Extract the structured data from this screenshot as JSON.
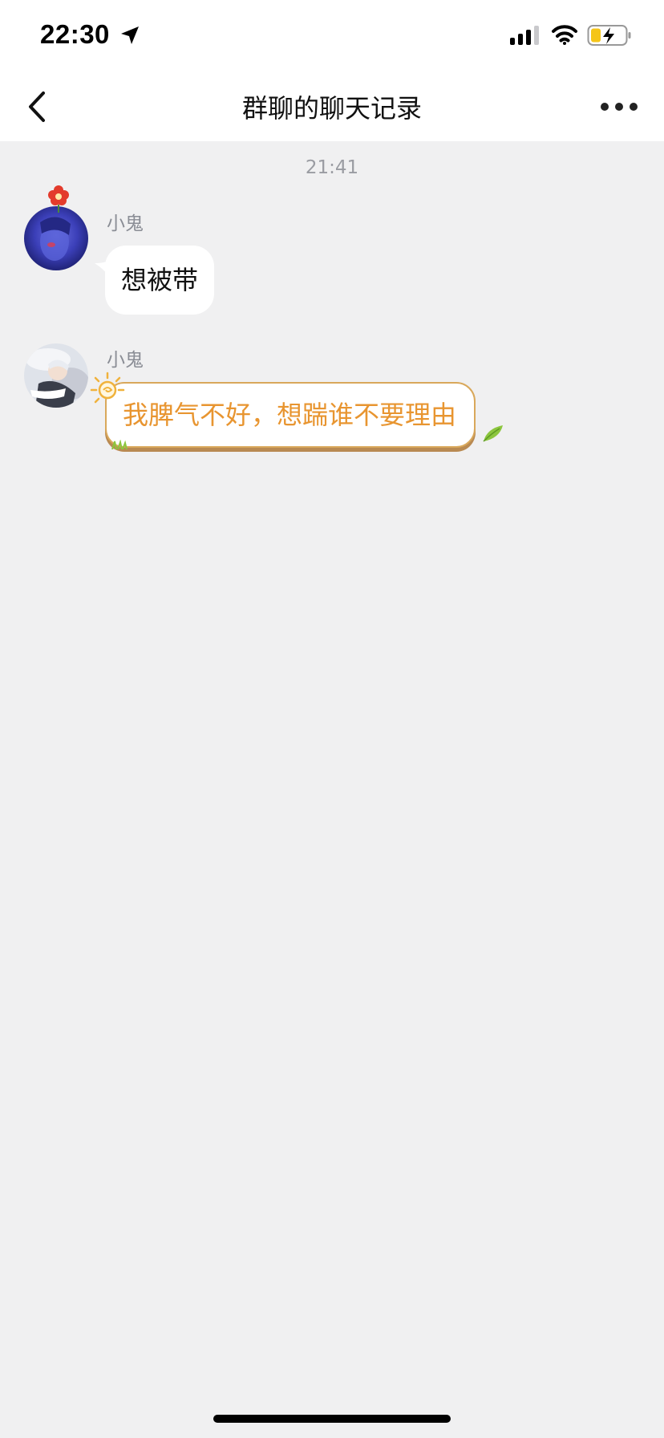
{
  "status_bar": {
    "time": "22:30",
    "icons": [
      "location-arrow-icon",
      "signal-icon",
      "wifi-icon",
      "battery-charging-icon"
    ]
  },
  "nav": {
    "title": "群聊的聊天记录",
    "back_icon": "chevron-left-icon",
    "more_icon": "more-dots-icon"
  },
  "chat": {
    "timestamp": "21:41",
    "messages": [
      {
        "sender": "小鬼",
        "text": "想被带",
        "style": "plain"
      },
      {
        "sender": "小鬼",
        "text": "我脾气不好，想踹谁不要理由",
        "style": "themed",
        "text_color": "#e89530",
        "border_color": "#d9a85b"
      }
    ]
  },
  "colors": {
    "background": "#f0f0f1",
    "header": "#ffffff",
    "timestamp": "#9a9ca2",
    "sender_name": "#8a8d95",
    "battery_fill": "#f5c518"
  }
}
